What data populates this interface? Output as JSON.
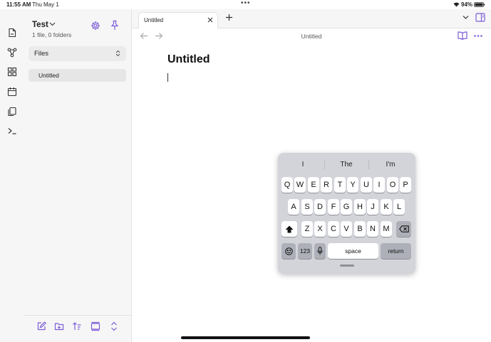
{
  "status_bar": {
    "time": "11:55 AM",
    "date": "Thu May 1",
    "battery": "94%"
  },
  "sidebar": {
    "vault_name": "Test",
    "vault_stats": "1 file, 0 folders",
    "view_selector": "Files",
    "files": [
      {
        "label": "Untitled"
      }
    ]
  },
  "tabs": [
    {
      "label": "Untitled"
    }
  ],
  "view_header": {
    "title": "Untitled"
  },
  "editor": {
    "note_title": "Untitled"
  },
  "keyboard": {
    "suggestions": [
      "I",
      "The",
      "I'm"
    ],
    "row1": [
      "Q",
      "W",
      "E",
      "R",
      "T",
      "Y",
      "U",
      "I",
      "O",
      "P"
    ],
    "row2": [
      "A",
      "S",
      "D",
      "F",
      "G",
      "H",
      "J",
      "K",
      "L"
    ],
    "row3": [
      "Z",
      "X",
      "C",
      "V",
      "B",
      "N",
      "M"
    ],
    "numbers_key": "123",
    "space_key": "space",
    "return_key": "return"
  },
  "colors": {
    "accent": "#7c5cd8",
    "sidebar_bg": "#f6f6f6",
    "keyboard_bg": "#d2d4d9"
  },
  "icons": {
    "ribbon": [
      "open-file-icon",
      "graph-icon",
      "canvas-icon",
      "daily-note-icon",
      "templates-icon",
      "command-palette-icon"
    ],
    "sidebar_bottom": [
      "new-note-icon",
      "new-folder-icon",
      "sort-icon",
      "collapse-icon",
      "expand-icon"
    ]
  }
}
